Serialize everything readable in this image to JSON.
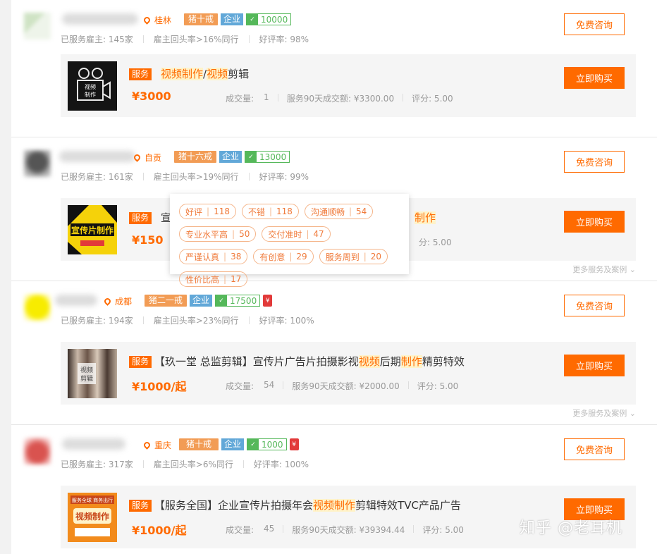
{
  "labels": {
    "consult": "免费咨询",
    "buy": "立即购买",
    "service_badge": "服务",
    "more": "更多服务及案例"
  },
  "colors": {
    "accent": "#ff6a00",
    "level_tag": "#f29c55",
    "corp_tag": "#62a8d8",
    "deposit": "#55b85a"
  },
  "cards": [
    {
      "city": "桂林",
      "level": "猪十戒",
      "corp": "企业",
      "deposit": "10000",
      "served": "已服务雇主: 145家",
      "return_rate": "雇主回头率>16%同行",
      "rating": "好评率: 98%",
      "title_parts": [
        "",
        "视频制作",
        "/",
        "视频",
        "剪辑"
      ],
      "price": "¥3000",
      "sales": "成交量:",
      "sales_val": "1",
      "amount": "服务90天成交额: ¥3300.00",
      "score": "评分: 5.00",
      "thumb_text": "视频\n制作"
    },
    {
      "city": "自贡",
      "level": "猪十六戒",
      "corp": "企业",
      "deposit": "13000",
      "served": "已服务雇主: 161家",
      "return_rate": "雇主回头率>19%同行",
      "rating": "好评率: 99%",
      "title_start": "宣",
      "title_end": "制作",
      "price": "¥150",
      "score": "分: 5.00",
      "thumb_text": "宣传片制作"
    },
    {
      "city": "成都",
      "level": "猪二一戒",
      "corp": "企业",
      "deposit": "17500",
      "served": "已服务雇主: 194家",
      "return_rate": "雇主回头率>23%同行",
      "rating": "好评率: 100%",
      "title_parts": [
        "【玖一堂 总监剪辑】宣传片广告片拍摄影视",
        "视频",
        "后期",
        "制作",
        "精剪特效"
      ],
      "price": "¥1000/起",
      "sales": "成交量:",
      "sales_val": "54",
      "amount": "服务90天成交额: ¥2000.00",
      "score": "评分: 5.00",
      "thumb_text": "视频\n剪辑"
    },
    {
      "city": "重庆",
      "level": "猪十戒",
      "corp": "企业",
      "deposit": "1000",
      "served": "已服务雇主: 317家",
      "return_rate": "雇主回头率>6%同行",
      "rating": "好评率: 100%",
      "title_parts": [
        "【服务全国】企业宣传片拍摄年会",
        "视频制作",
        "剪辑特效TVC产品广告",
        "",
        ""
      ],
      "price": "¥1000/起",
      "sales": "成交量:",
      "sales_val": "45",
      "amount": "服务90天成交额: ¥39394.44",
      "score": "评分: 5.00",
      "thumb_text": "视频制作"
    }
  ],
  "review_tags": [
    {
      "label": "好评",
      "count": "118"
    },
    {
      "label": "不错",
      "count": "118"
    },
    {
      "label": "沟通顺畅",
      "count": "54"
    },
    {
      "label": "专业水平高",
      "count": "50"
    },
    {
      "label": "交付准时",
      "count": "47"
    },
    {
      "label": "严谨认真",
      "count": "38"
    },
    {
      "label": "有创意",
      "count": "29"
    },
    {
      "label": "服务周到",
      "count": "20"
    },
    {
      "label": "性价比高",
      "count": "17"
    }
  ],
  "watermark": "知乎 @老耳机"
}
